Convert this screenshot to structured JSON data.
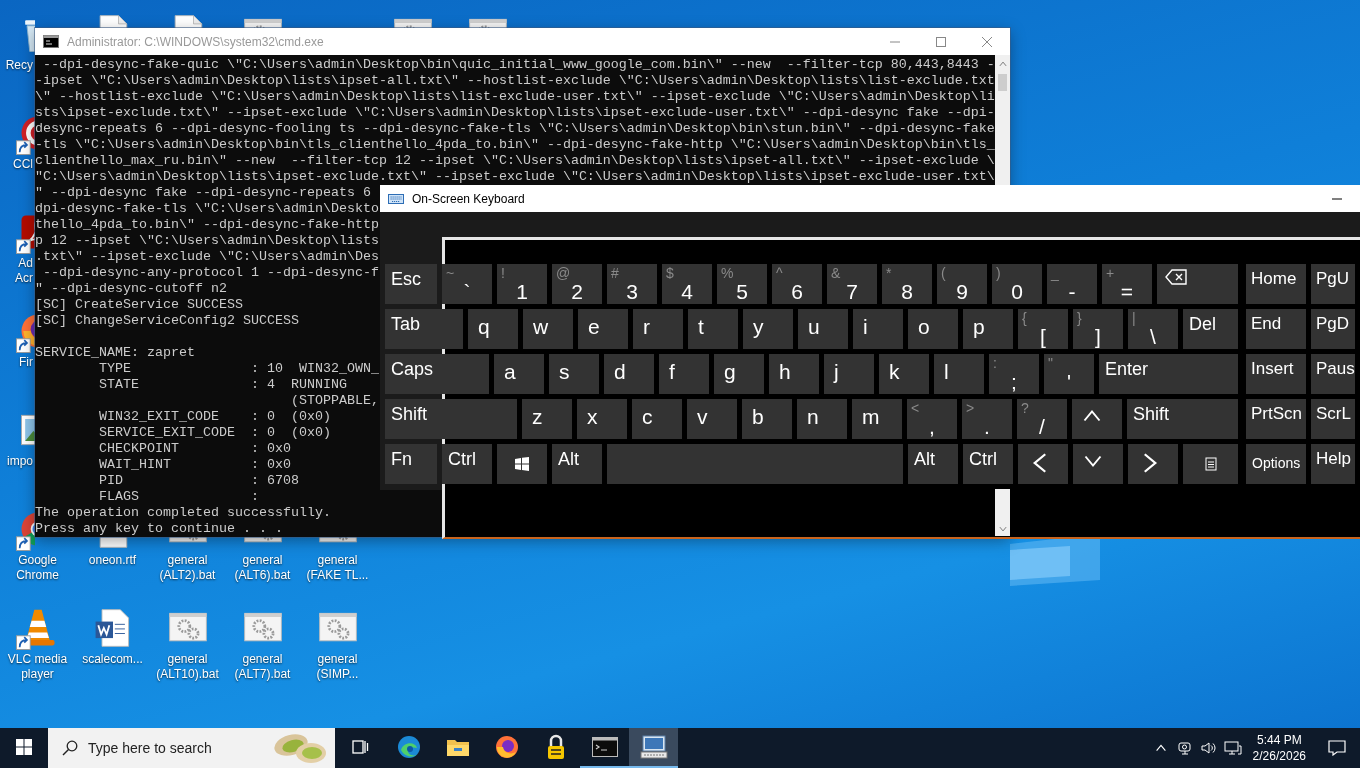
{
  "desktop_icons": [
    {
      "kind": "recycle-bin",
      "label": "Recy",
      "shortcut": false
    },
    {
      "kind": "cleaner",
      "label": "CCl",
      "shortcut": true
    },
    {
      "kind": "pdf-app",
      "label": "Ad Acr",
      "shortcut": true
    },
    {
      "kind": "firefox",
      "label": "Fir",
      "shortcut": true
    },
    {
      "kind": "image",
      "label": "impo",
      "shortcut": false
    },
    {
      "kind": "chrome",
      "label": "Google Chrome",
      "shortcut": true
    },
    {
      "kind": "vlc",
      "label": "VLC media player",
      "shortcut": true
    },
    {
      "kind": "document"
    },
    {
      "kind": "document",
      "label": "oneon.rtf",
      "shortcut": false
    },
    {
      "kind": "word",
      "label": "scalecom...",
      "shortcut": false
    },
    {
      "kind": "document"
    },
    {
      "kind": "batch",
      "label": "general (ALT2).bat",
      "shortcut": false
    },
    {
      "kind": "batch",
      "label": "general (ALT10).bat",
      "shortcut": false
    },
    {
      "kind": "batch"
    },
    {
      "kind": "batch",
      "label": "general (ALT6).bat",
      "shortcut": false
    },
    {
      "kind": "batch",
      "label": "general (ALT7).bat",
      "shortcut": false
    },
    {
      "kind": "batch",
      "label": "general (FAKE TL...",
      "shortcut": false
    },
    {
      "kind": "batch",
      "label": "general (SIMP...",
      "shortcut": false
    },
    {
      "kind": "batch"
    },
    {
      "kind": "batch"
    }
  ],
  "cmd_window": {
    "title": "Administrator: C:\\WINDOWS\\system32\\cmd.exe",
    "active": false,
    "output_blocks": [
      [
        " --dpi-desync-fake-quic \\\"C:\\Users\\admin\\Desktop\\bin\\quic_initial_www_google_com.bin\\\" --new  --filter-tcp 80,443,8443 -",
        "-ipset \\\"C:\\Users\\admin\\Desktop\\lists\\ipset-all.txt\\\" --hostlist-exclude \\\"C:\\Users\\admin\\Desktop\\lists\\list-exclude.txt",
        "\\\" --hostlist-exclude \\\"C:\\Users\\admin\\Desktop\\lists\\list-exclude-user.txt\\\" --ipset-exclude \\\"C:\\Users\\admin\\Desktop\\li",
        "sts\\ipset-exclude.txt\\\" --ipset-exclude \\\"C:\\Users\\admin\\Desktop\\lists\\ipset-exclude-user.txt\\\" --dpi-desync fake --dpi-",
        "desync-repeats 6 --dpi-desync-fooling ts --dpi-desync-fake-tls \\\"C:\\Users\\admin\\Desktop\\bin\\stun.bin\\\" --dpi-desync-fake",
        "-tls \\\"C:\\Users\\admin\\Desktop\\bin\\tls_clienthello_4pda_to.bin\\\" --dpi-desync-fake-http \\\"C:\\Users\\admin\\Desktop\\bin\\tls_",
        "clienthello_max_ru.bin\\\" --new  --filter-tcp 12 --ipset \\\"C:\\Users\\admin\\Desktop\\lists\\ipset-all.txt\\\" --ipset-exclude \\",
        "\"C:\\Users\\admin\\Desktop\\lists\\ipset-exclude.txt\\\" --ipset-exclude \\\"C:\\Users\\admin\\Desktop\\lists\\ipset-exclude-user.txt\\",
        "\" --dpi-desync fake --dpi-desync-repeats 6",
        "dpi-desync-fake-tls \\\"C:\\Users\\admin\\Deskto",
        "thello_4pda_to.bin\\\" --dpi-desync-fake-http",
        "p 12 --ipset \\\"C:\\Users\\admin\\Desktop\\lists",
        ".txt\\\" --ipset-exclude \\\"C:\\Users\\admin\\Des",
        " --dpi-desync-any-protocol 1 --dpi-desync-f",
        "\" --dpi-desync-cutoff n2",
        "[SC] CreateService SUCCESS",
        "[SC] ChangeServiceConfig2 SUCCESS"
      ],
      [
        "SERVICE_NAME: zapret",
        "        TYPE               : 10  WIN32_OWN_",
        "        STATE              : 4  RUNNING",
        "                                (STOPPABLE,",
        "        WIN32_EXIT_CODE    : 0  (0x0)",
        "        SERVICE_EXIT_CODE  : 0  (0x0)",
        "        CHECKPOINT         : 0x0",
        "        WAIT_HINT          : 0x0",
        "        PID                : 6708",
        "        FLAGS              :",
        "The operation completed successfully.",
        "Press any key to continue . . ."
      ]
    ]
  },
  "keyboard_window": {
    "title": "On-Screen Keyboard",
    "active": true,
    "rows": [
      {
        "keys": [
          {
            "kind": "name",
            "label": "Esc"
          },
          {
            "kind": "char",
            "label": "`",
            "shift": "~"
          },
          {
            "kind": "char",
            "label": "1",
            "shift": "!"
          },
          {
            "kind": "char",
            "label": "2",
            "shift": "@"
          },
          {
            "kind": "char",
            "label": "3",
            "shift": "#"
          },
          {
            "kind": "char",
            "label": "4",
            "shift": "$"
          },
          {
            "kind": "char",
            "label": "5",
            "shift": "%"
          },
          {
            "kind": "char",
            "label": "6",
            "shift": "^"
          },
          {
            "kind": "char",
            "label": "7",
            "shift": "&"
          },
          {
            "kind": "char",
            "label": "8",
            "shift": "*"
          },
          {
            "kind": "char",
            "label": "9",
            "shift": "("
          },
          {
            "kind": "char",
            "label": "0",
            "shift": ")"
          },
          {
            "kind": "char",
            "label": "-",
            "shift": "_"
          },
          {
            "kind": "char",
            "label": "=",
            "shift": "+"
          },
          {
            "kind": "backspace"
          }
        ]
      },
      {
        "keys": [
          {
            "kind": "name",
            "label": "Tab"
          },
          {
            "kind": "letter",
            "label": "q"
          },
          {
            "kind": "letter",
            "label": "w"
          },
          {
            "kind": "letter",
            "label": "e"
          },
          {
            "kind": "letter",
            "label": "r"
          },
          {
            "kind": "letter",
            "label": "t"
          },
          {
            "kind": "letter",
            "label": "y"
          },
          {
            "kind": "letter",
            "label": "u"
          },
          {
            "kind": "letter",
            "label": "i"
          },
          {
            "kind": "letter",
            "label": "o"
          },
          {
            "kind": "letter",
            "label": "p"
          },
          {
            "kind": "char",
            "label": "[",
            "shift": "{"
          },
          {
            "kind": "char",
            "label": "]",
            "shift": "}"
          },
          {
            "kind": "char",
            "label": "\\",
            "shift": "|"
          },
          {
            "kind": "name",
            "label": "Del"
          }
        ]
      },
      {
        "keys": [
          {
            "kind": "name",
            "label": "Caps"
          },
          {
            "kind": "letter",
            "label": "a"
          },
          {
            "kind": "letter",
            "label": "s"
          },
          {
            "kind": "letter",
            "label": "d"
          },
          {
            "kind": "letter",
            "label": "f"
          },
          {
            "kind": "letter",
            "label": "g"
          },
          {
            "kind": "letter",
            "label": "h"
          },
          {
            "kind": "letter",
            "label": "j"
          },
          {
            "kind": "letter",
            "label": "k"
          },
          {
            "kind": "letter",
            "label": "l"
          },
          {
            "kind": "char",
            "label": ";",
            "shift": ":"
          },
          {
            "kind": "char",
            "label": "'",
            "shift": "\""
          },
          {
            "kind": "name",
            "label": "Enter"
          }
        ]
      },
      {
        "keys": [
          {
            "kind": "name",
            "label": "Shift"
          },
          {
            "kind": "letter",
            "label": "z"
          },
          {
            "kind": "letter",
            "label": "x"
          },
          {
            "kind": "letter",
            "label": "c"
          },
          {
            "kind": "letter",
            "label": "v"
          },
          {
            "kind": "letter",
            "label": "b"
          },
          {
            "kind": "letter",
            "label": "n"
          },
          {
            "kind": "letter",
            "label": "m"
          },
          {
            "kind": "char",
            "label": ",",
            "shift": "<"
          },
          {
            "kind": "char",
            "label": ".",
            "shift": ">"
          },
          {
            "kind": "char",
            "label": "/",
            "shift": "?"
          },
          {
            "kind": "arrow-up"
          },
          {
            "kind": "name",
            "label": "Shift"
          }
        ]
      },
      {
        "keys": [
          {
            "kind": "name",
            "label": "Fn"
          },
          {
            "kind": "name",
            "label": "Ctrl"
          },
          {
            "kind": "windows"
          },
          {
            "kind": "name",
            "label": "Alt"
          },
          {
            "kind": "space"
          },
          {
            "kind": "name",
            "label": "Alt"
          },
          {
            "kind": "name",
            "label": "Ctrl"
          },
          {
            "kind": "arrow-left"
          },
          {
            "kind": "arrow-down"
          },
          {
            "kind": "arrow-right"
          },
          {
            "kind": "menu"
          }
        ]
      }
    ],
    "side_keys": [
      {
        "keys": [
          {
            "kind": "nav",
            "label": "Home"
          },
          {
            "kind": "nav",
            "label": "PgU"
          }
        ]
      },
      {
        "keys": [
          {
            "kind": "nav",
            "label": "End"
          },
          {
            "kind": "nav",
            "label": "PgD"
          }
        ]
      },
      {
        "keys": [
          {
            "kind": "nav",
            "label": "Insert"
          },
          {
            "kind": "nav",
            "label": "Paus"
          }
        ]
      },
      {
        "keys": [
          {
            "kind": "nav",
            "label": "PrtScn"
          },
          {
            "kind": "nav",
            "label": "ScrL"
          }
        ]
      },
      {
        "keys": [
          {
            "kind": "setting",
            "label": "Options"
          },
          {
            "kind": "nav",
            "label": "Help"
          }
        ]
      }
    ]
  },
  "taskbar": {
    "search": {
      "placeholder": "Type here to search"
    },
    "apps": [
      {
        "kind": "task-view",
        "running": false,
        "selected": false
      },
      {
        "kind": "edge",
        "running": false,
        "selected": false
      },
      {
        "kind": "explorer",
        "running": false,
        "selected": false
      },
      {
        "kind": "firefox",
        "running": false,
        "selected": false
      },
      {
        "kind": "lock",
        "running": false,
        "selected": false
      },
      {
        "kind": "terminal",
        "running": true,
        "selected": false
      },
      {
        "kind": "keyboard",
        "running": true,
        "selected": true
      }
    ],
    "clock": {
      "time": "5:44 PM",
      "date": "2/26/2026"
    }
  }
}
